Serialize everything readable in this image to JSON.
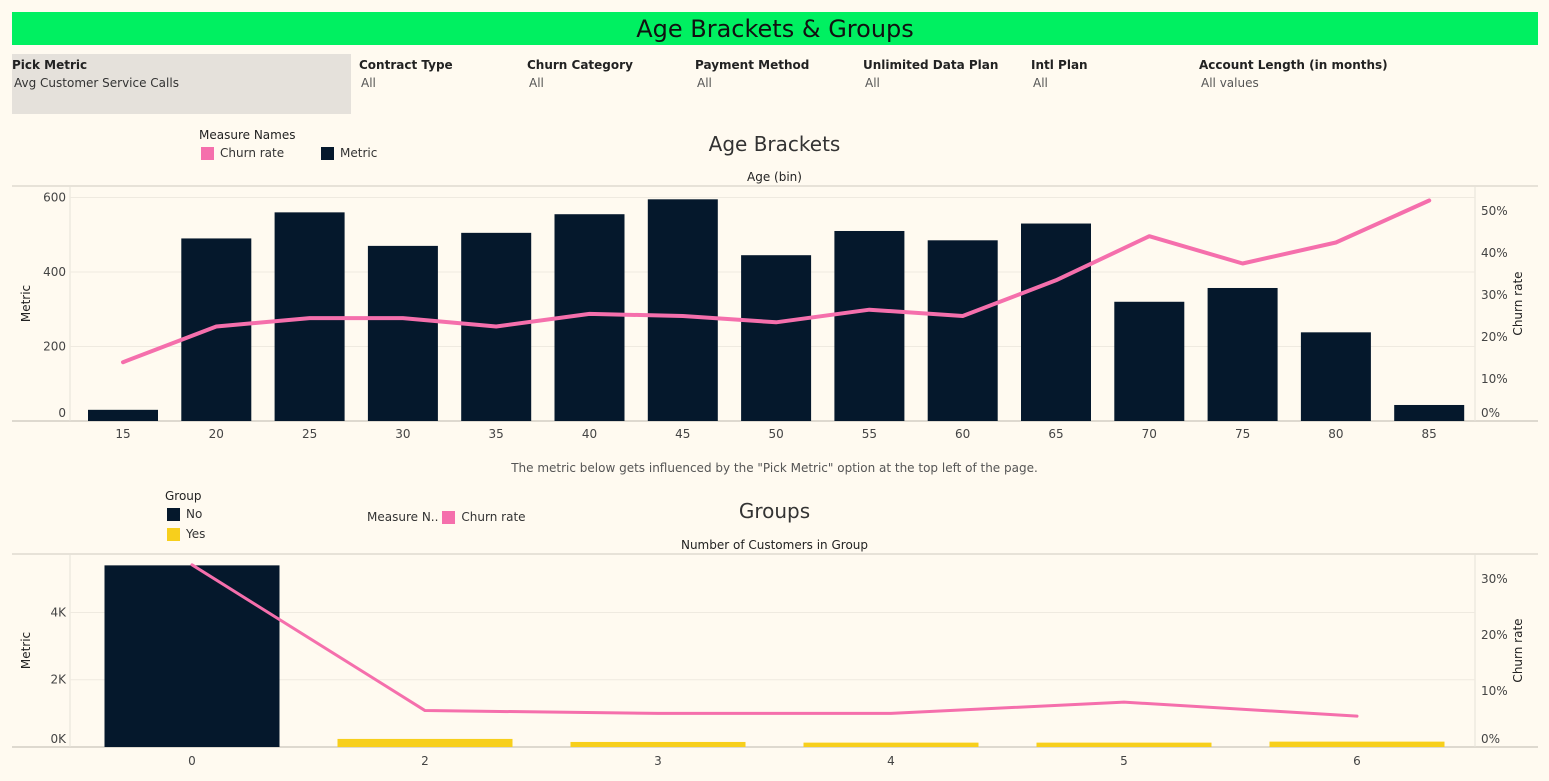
{
  "header": {
    "title": "Age Brackets & Groups"
  },
  "filters": {
    "pick_metric": {
      "label": "Pick Metric",
      "value": "Avg Customer Service Calls"
    },
    "contract_type": {
      "label": "Contract Type",
      "value": "All"
    },
    "churn_category": {
      "label": "Churn Category",
      "value": "All"
    },
    "payment_method": {
      "label": "Payment Method",
      "value": "All"
    },
    "unlimited_data_plan": {
      "label": "Unlimited Data Plan",
      "value": "All"
    },
    "intl_plan": {
      "label": "Intl Plan",
      "value": "All"
    },
    "account_length": {
      "label": "Account Length (in months)",
      "value": "All values"
    }
  },
  "note": "The metric below gets influenced by the \"Pick Metric\" option at the top left of the page.",
  "colors": {
    "bar": "#05182c",
    "line": "#f56fac",
    "yes": "#f7cf1c",
    "header": "#00f061"
  },
  "chart_data": [
    {
      "type": "bar",
      "title": "Age Brackets",
      "xlabel": "Age (bin)",
      "ylabel": "Metric",
      "y2label": "Churn rate",
      "legend_title": "Measure Names",
      "legend": [
        "Churn rate",
        "Metric"
      ],
      "categories": [
        "15",
        "20",
        "25",
        "30",
        "35",
        "40",
        "45",
        "50",
        "55",
        "60",
        "65",
        "70",
        "75",
        "80",
        "85"
      ],
      "ylim": [
        0,
        620
      ],
      "y2lim": [
        0,
        0.55
      ],
      "yticks": [
        "0",
        "200",
        "400",
        "600"
      ],
      "y2ticks": [
        "0%",
        "10%",
        "20%",
        "30%",
        "40%",
        "50%"
      ],
      "series": [
        {
          "name": "Metric",
          "type": "bar",
          "values": [
            30,
            490,
            560,
            470,
            505,
            555,
            595,
            445,
            510,
            485,
            530,
            320,
            357,
            238,
            43
          ]
        },
        {
          "name": "Churn rate",
          "type": "line",
          "axis": "right",
          "values": [
            0.14,
            0.225,
            0.245,
            0.245,
            0.225,
            0.255,
            0.25,
            0.235,
            0.265,
            0.25,
            0.335,
            0.44,
            0.375,
            0.425,
            0.525
          ]
        }
      ]
    },
    {
      "type": "bar",
      "title": "Groups",
      "xlabel": "Number of Customers in Group",
      "ylabel": "Metric",
      "y2label": "Churn rate",
      "legend_title": "Group",
      "legend": [
        "No",
        "Yes"
      ],
      "legend2_title": "Measure N..",
      "legend2": [
        "Churn rate"
      ],
      "categories": [
        "0",
        "2",
        "3",
        "4",
        "5",
        "6"
      ],
      "ylim": [
        0,
        5500
      ],
      "y2lim": [
        0,
        0.33
      ],
      "yticks": [
        "0K",
        "2K",
        "4K"
      ],
      "y2ticks": [
        "0%",
        "10%",
        "20%",
        "30%"
      ],
      "series": [
        {
          "name": "Metric",
          "type": "bar",
          "values": [
            5400,
            240,
            150,
            130,
            130,
            160
          ],
          "groups": [
            "No",
            "Yes",
            "Yes",
            "Yes",
            "Yes",
            "Yes"
          ]
        },
        {
          "name": "Churn rate",
          "type": "line",
          "axis": "right",
          "values": [
            0.325,
            0.065,
            0.06,
            0.06,
            0.08,
            0.055
          ]
        }
      ]
    }
  ]
}
